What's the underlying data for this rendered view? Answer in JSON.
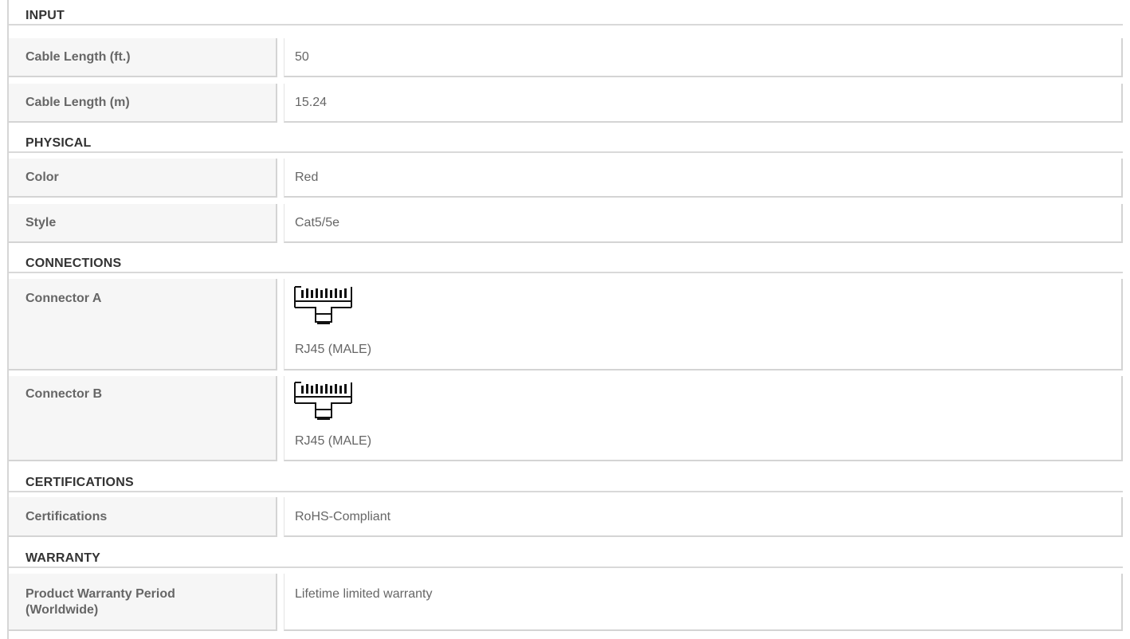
{
  "sections": {
    "input": {
      "title": "INPUT",
      "rows": [
        {
          "label": "Cable Length (ft.)",
          "value": "50"
        },
        {
          "label": "Cable Length (m)",
          "value": "15.24"
        }
      ]
    },
    "physical": {
      "title": "PHYSICAL",
      "rows": [
        {
          "label": "Color",
          "value": "Red"
        },
        {
          "label": "Style",
          "value": "Cat5/5e"
        }
      ]
    },
    "connections": {
      "title": "CONNECTIONS",
      "rows": [
        {
          "label": "Connector A",
          "value": "RJ45 (MALE)",
          "icon": "rj45-connector-icon"
        },
        {
          "label": "Connector B",
          "value": "RJ45 (MALE)",
          "icon": "rj45-connector-icon"
        }
      ]
    },
    "certifications": {
      "title": "CERTIFICATIONS",
      "rows": [
        {
          "label": "Certifications",
          "value": "RoHS-Compliant"
        }
      ]
    },
    "warranty": {
      "title": "WARRANTY",
      "rows": [
        {
          "label_line1": "Product Warranty Period",
          "label_line2": "(Worldwide)",
          "value": "Lifetime limited warranty"
        }
      ]
    }
  },
  "colors": {
    "label_background": "#f6f6f6",
    "border": "#d4d4d4",
    "heading_text": "#333333",
    "body_text": "#666666"
  }
}
